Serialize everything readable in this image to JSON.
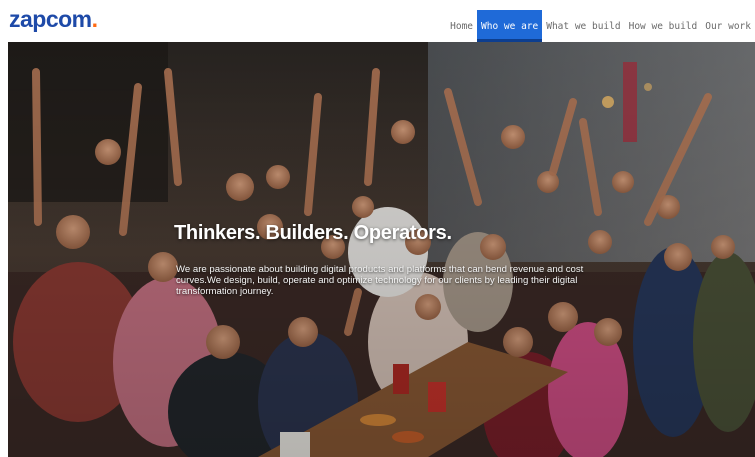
{
  "brand": {
    "name": "zapcom",
    "dot": ".",
    "color": "#1e4aa8",
    "dot_color": "#ff6a13"
  },
  "nav": {
    "items": [
      {
        "label": "Home",
        "active": false
      },
      {
        "label": "Who we are",
        "active": true
      },
      {
        "label": "What we build",
        "active": false
      },
      {
        "label": "How we build",
        "active": false
      },
      {
        "label": "Our work",
        "active": false
      }
    ],
    "active_color": "#1f6ad8"
  },
  "hero": {
    "image": "team-group-photo",
    "headline": "Thinkers. Builders. Operators.",
    "description": "We are passionate about building digital products and platforms that can bend revenue and cost curves.We design, build, operate and optimize technology for our clients by leading their digital transformation journey."
  }
}
